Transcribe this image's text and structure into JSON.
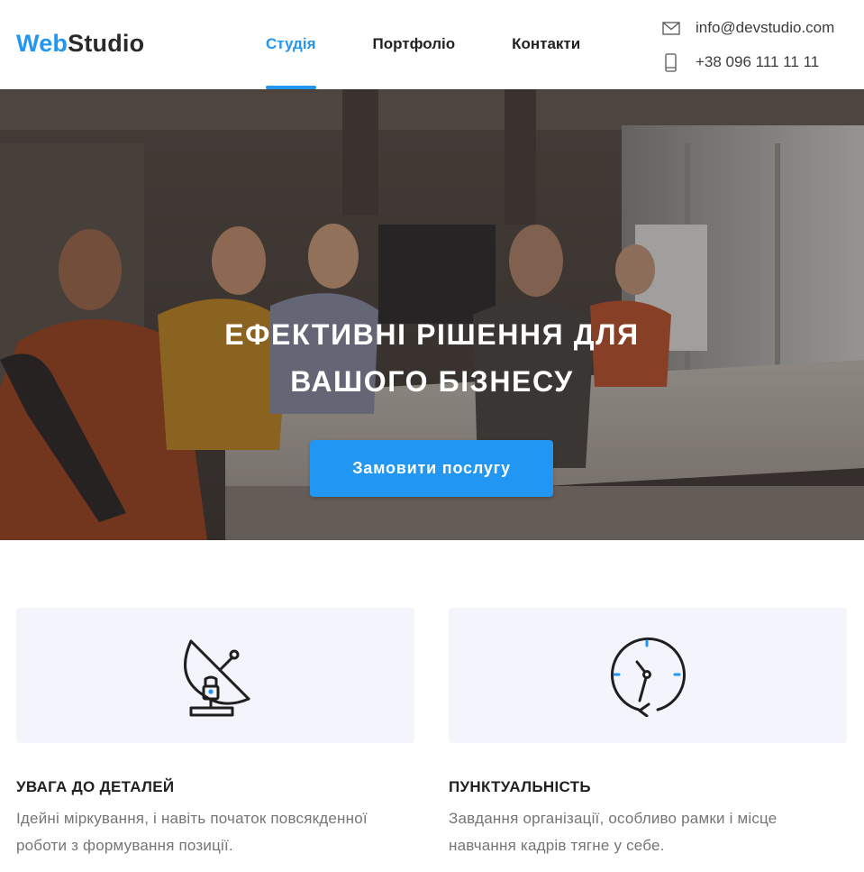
{
  "header": {
    "logo": {
      "part1": "Web",
      "part2": "Studio"
    },
    "nav": [
      {
        "label": "Студія",
        "active": true
      },
      {
        "label": "Портфоліо",
        "active": false
      },
      {
        "label": "Контакти",
        "active": false
      }
    ],
    "contacts": {
      "email": "info@devstudio.com",
      "email_icon": "envelope-icon",
      "phone": "+38 096 111 11 11",
      "phone_icon": "smartphone-icon"
    }
  },
  "hero": {
    "title_line1": "Ефективні рішення для",
    "title_line2": "вашого бізнесу",
    "button_label": "Замовити послугу",
    "image": "team-at-office-table-photo"
  },
  "features": [
    {
      "icon": "satellite-dish-icon",
      "title": "Увага до деталей",
      "text_line1": "Ідейні міркування, і навіть початок повсякденної",
      "text_line2": "роботи з формування позиції."
    },
    {
      "icon": "clock-icon",
      "title": "Пунктуальність",
      "text_line1": "Завдання організації, особливо рамки і місце",
      "text_line2": "навчання кадрів тягне у себе."
    }
  ],
  "colors": {
    "accent": "#2196F3",
    "feature_bg": "#F4F4FD",
    "text_dark": "#212121",
    "text_muted": "#757575"
  }
}
